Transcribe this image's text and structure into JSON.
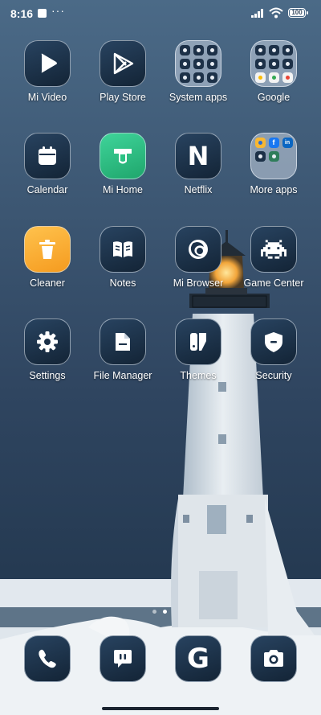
{
  "status": {
    "time": "8:16",
    "dots": "···",
    "battery": "100",
    "icons": [
      "notification-square-icon",
      "signal-icon",
      "wifi-icon",
      "battery-icon"
    ]
  },
  "apps": [
    {
      "label": "Mi Video",
      "icon": "play-icon"
    },
    {
      "label": "Play Store",
      "icon": "play-store-icon"
    },
    {
      "label": "System apps",
      "icon": "folder-icon"
    },
    {
      "label": "Google",
      "icon": "folder-icon"
    },
    {
      "label": "Calendar",
      "icon": "calendar-icon"
    },
    {
      "label": "Mi Home",
      "icon": "mi-home-icon"
    },
    {
      "label": "Netflix",
      "icon": "netflix-n-icon",
      "glyph": "N"
    },
    {
      "label": "More apps",
      "icon": "folder-icon"
    },
    {
      "label": "Cleaner",
      "icon": "trash-icon"
    },
    {
      "label": "Notes",
      "icon": "book-icon"
    },
    {
      "label": "Mi Browser",
      "icon": "globe-icon"
    },
    {
      "label": "Game Center",
      "icon": "space-invader-icon"
    },
    {
      "label": "Settings",
      "icon": "gear-icon"
    },
    {
      "label": "File Manager",
      "icon": "file-icon"
    },
    {
      "label": "Themes",
      "icon": "theme-brush-icon"
    },
    {
      "label": "Security",
      "icon": "shield-icon"
    }
  ],
  "dock": [
    {
      "name": "phone",
      "icon": "phone-icon"
    },
    {
      "name": "messages",
      "icon": "message-icon"
    },
    {
      "name": "google",
      "icon": "google-g-icon",
      "glyph": "G"
    },
    {
      "name": "camera",
      "icon": "camera-icon"
    }
  ],
  "colors": {
    "accent_green": "#2ac283",
    "accent_orange": "#f7ac32",
    "icon_tile": "#1b3048",
    "sky": "#3b5470"
  }
}
